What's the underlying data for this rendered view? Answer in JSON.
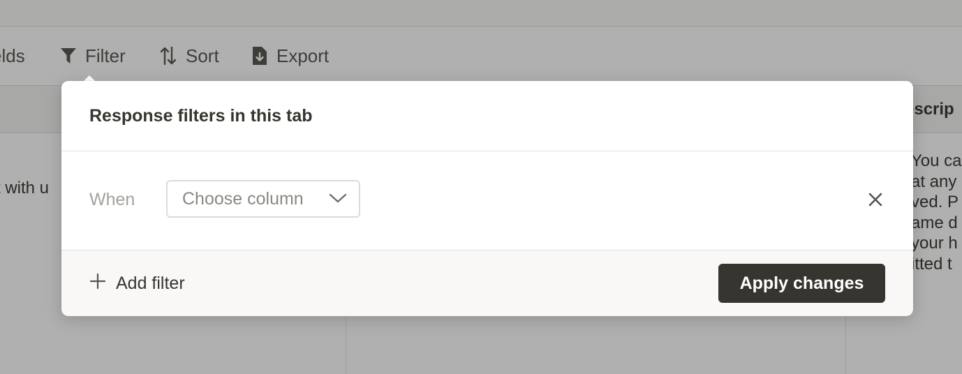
{
  "toolbar": {
    "fields_label": "elds",
    "filter_label": "Filter",
    "sort_label": "Sort",
    "export_label": "Export"
  },
  "table": {
    "description_header": "escrip",
    "row_text_left": "t with u",
    "description_lines": [
      "You ca",
      "at any",
      "ved. P",
      "ame d",
      "your h",
      "itted t"
    ]
  },
  "popover": {
    "title": "Response filters in this tab",
    "when_label": "When",
    "column_select_placeholder": "Choose column",
    "add_filter_label": "Add filter",
    "apply_label": "Apply changes"
  },
  "icons": {
    "filter": "funnel-icon",
    "sort": "sort-arrows-icon",
    "export": "export-document-icon",
    "chevron": "chevron-down-icon",
    "close": "close-icon",
    "add": "plus-icon"
  },
  "colors": {
    "primary_button": "#37352f",
    "overlay": "rgba(15,15,15,0.32)"
  }
}
